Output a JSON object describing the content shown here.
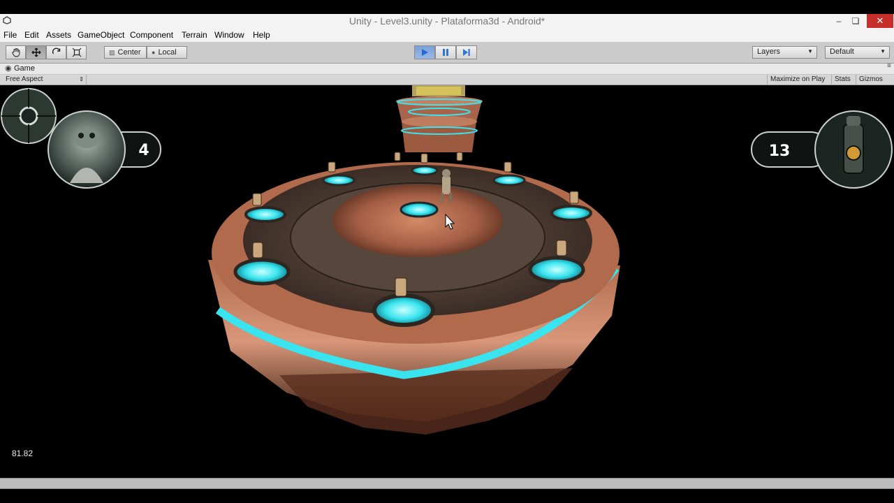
{
  "window": {
    "title": "Unity - Level3.unity - Plataforma3d - Android*",
    "minimize": "–",
    "restore": "❏",
    "close": "✕"
  },
  "menu": [
    "File",
    "Edit",
    "Assets",
    "GameObject",
    "Component",
    "Terrain",
    "Window",
    "Help"
  ],
  "toolbar": {
    "tools": [
      "hand-icon",
      "move-icon",
      "rotate-icon",
      "scale-icon"
    ],
    "pivot_label": "Center",
    "space_label": "Local",
    "layers_label": "Layers",
    "layout_label": "Default"
  },
  "game_tab": {
    "label": "Game"
  },
  "game_bar": {
    "aspect": "Free Aspect",
    "maximize": "Maximize on Play",
    "stats": "Stats",
    "gizmos": "Gizmos"
  },
  "hud": {
    "lives": "4",
    "score": "13",
    "fps": "81.82"
  },
  "colors": {
    "accent_cyan": "#39e4ee",
    "platform": "#b46a4e",
    "play_blue": "#2f74d8",
    "close_red": "#c7302a"
  }
}
